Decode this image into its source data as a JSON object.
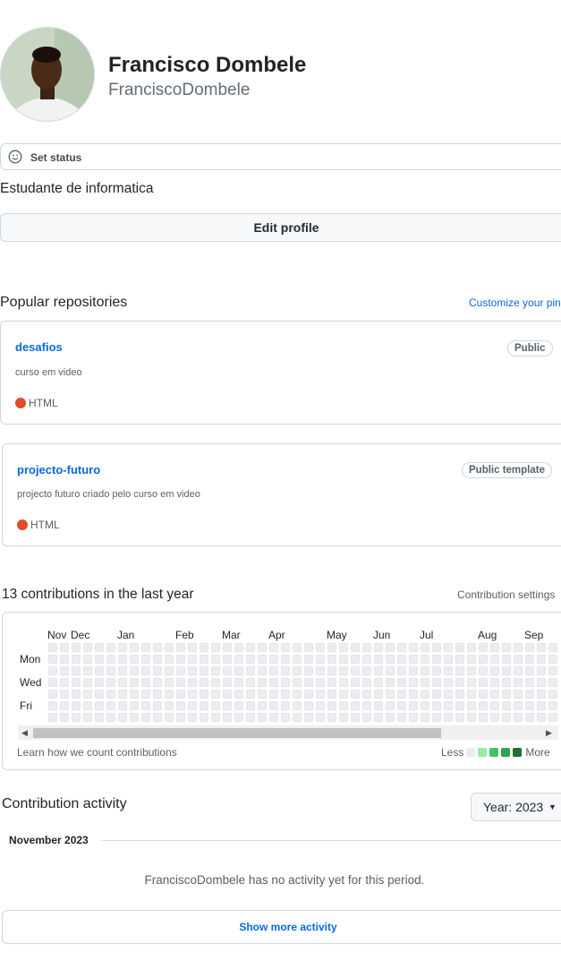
{
  "profile": {
    "full_name": "Francisco Dombele",
    "username": "FranciscoDombele",
    "status_label": "Set status",
    "bio": "Estudante de informatica",
    "edit_label": "Edit profile"
  },
  "popular": {
    "title": "Popular repositories",
    "customize_link": "Customize your pin",
    "repos": [
      {
        "name": "desafios",
        "visibility": "Public",
        "description": "curso em video",
        "language": "HTML",
        "language_color": "#e34c26"
      },
      {
        "name": "projecto-futuro",
        "visibility": "Public template",
        "description": "projecto futuro criado pelo curso em video",
        "language": "HTML",
        "language_color": "#e34c26"
      }
    ]
  },
  "contributions": {
    "title": "13 contributions in the last year",
    "settings_link": "Contribution settings",
    "months": [
      "Nov",
      "Dec",
      "Jan",
      "Feb",
      "Mar",
      "Apr",
      "May",
      "Jun",
      "Jul",
      "Aug",
      "Sep"
    ],
    "days": [
      "Mon",
      "Wed",
      "Fri"
    ],
    "learn_link": "Learn how we count contributions",
    "legend_less": "Less",
    "legend_more": "More",
    "legend_colors": [
      "#ebedf0",
      "#9be9a8",
      "#40c463",
      "#30a14e",
      "#216e39"
    ]
  },
  "activity": {
    "title": "Contribution activity",
    "year_button": "Year: 2023",
    "month_heading": "November 2023",
    "empty_message": "FranciscoDombele has no activity yet for this period.",
    "show_more": "Show more activity"
  }
}
